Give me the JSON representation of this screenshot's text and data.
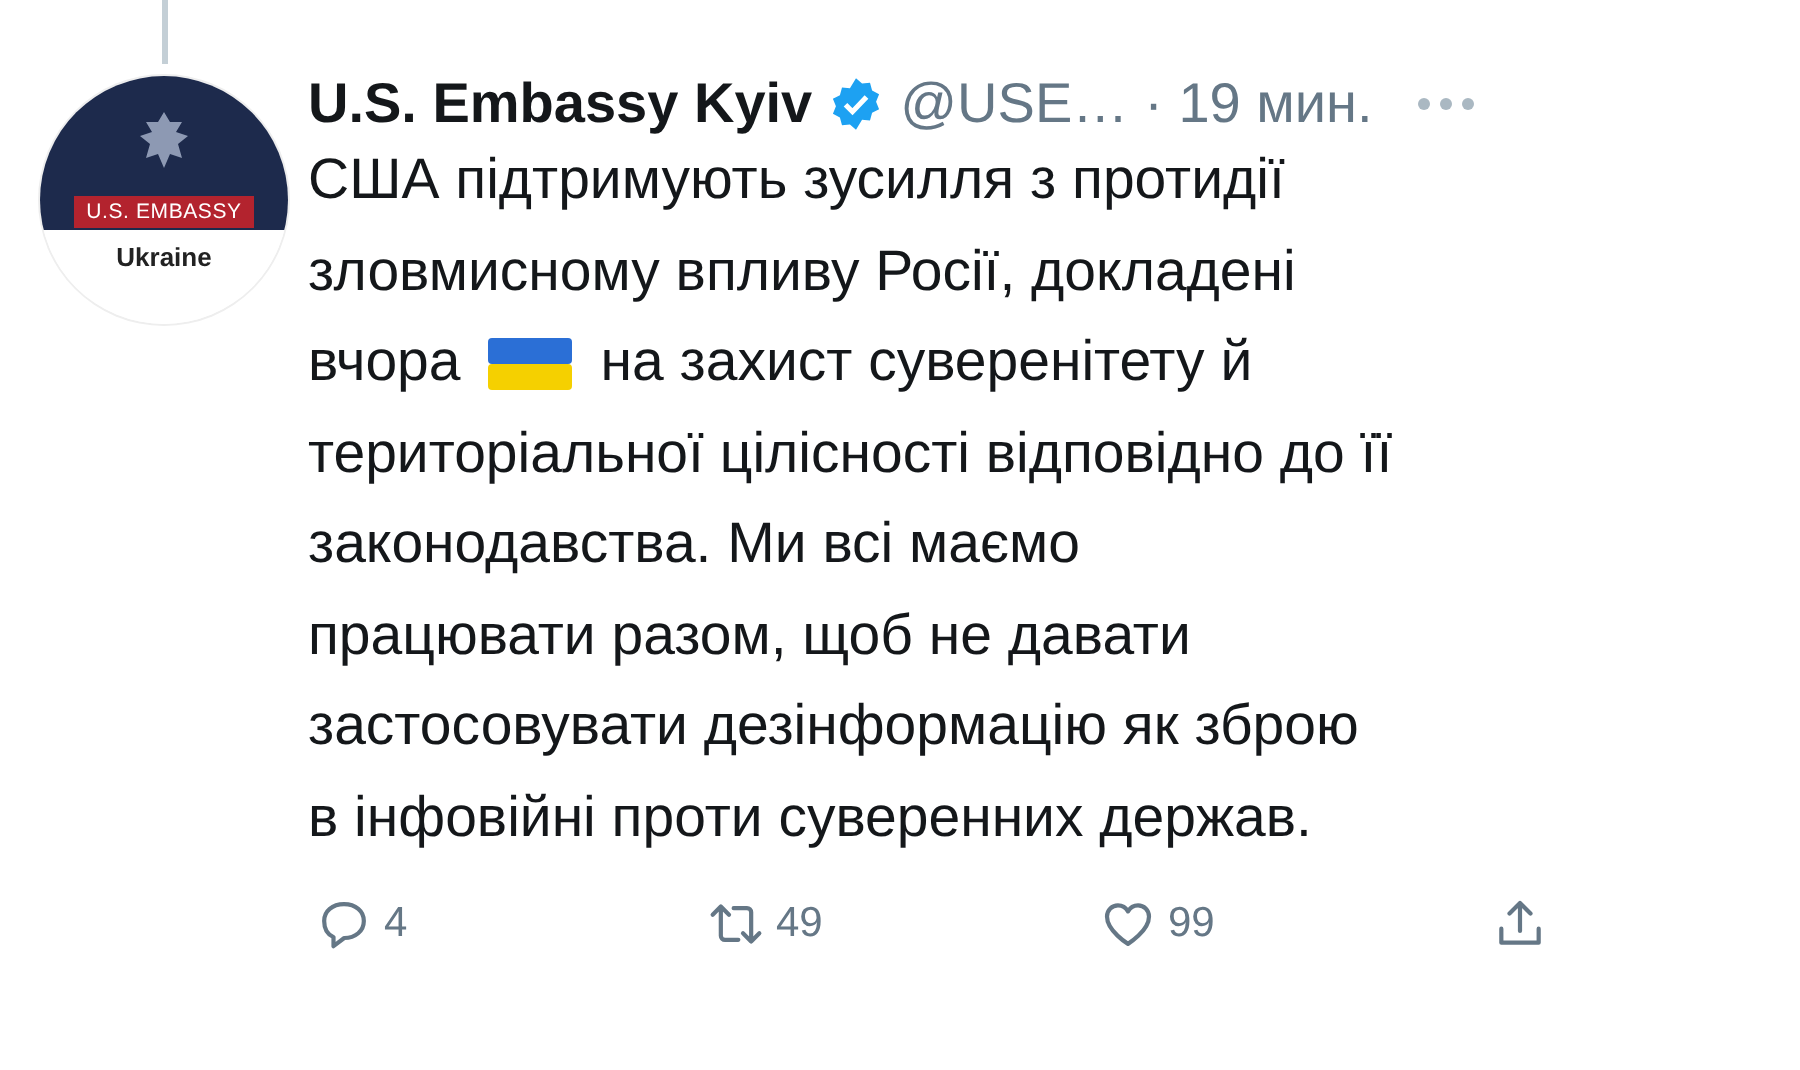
{
  "avatar": {
    "banner": "U.S. EMBASSY",
    "caption": "Ukraine"
  },
  "tweet": {
    "name": "U.S. Embassy Kyiv",
    "verified": true,
    "handle": "@USE…",
    "time": "· 19 мин.",
    "lines": [
      {
        "text": "США підтримують зусилля з протидії"
      },
      {
        "text": "зловмисному впливу Росії, докладені"
      },
      {
        "kind": "flag",
        "before": "вчора",
        "after": "на захист суверенітету й"
      },
      {
        "text": "територіальної цілісності відповідно до її"
      },
      {
        "text": "законодавства. Ми всі маємо"
      },
      {
        "text": "працювати разом, щоб не давати"
      },
      {
        "text": "застосовувати дезінформацію як зброю"
      },
      {
        "text": "в інфовійні проти суверенних держав."
      }
    ]
  },
  "actions": [
    {
      "kind": "reply",
      "count": "4"
    },
    {
      "kind": "retweet",
      "count": "49"
    },
    {
      "kind": "like",
      "count": "99"
    },
    {
      "kind": "share"
    }
  ]
}
